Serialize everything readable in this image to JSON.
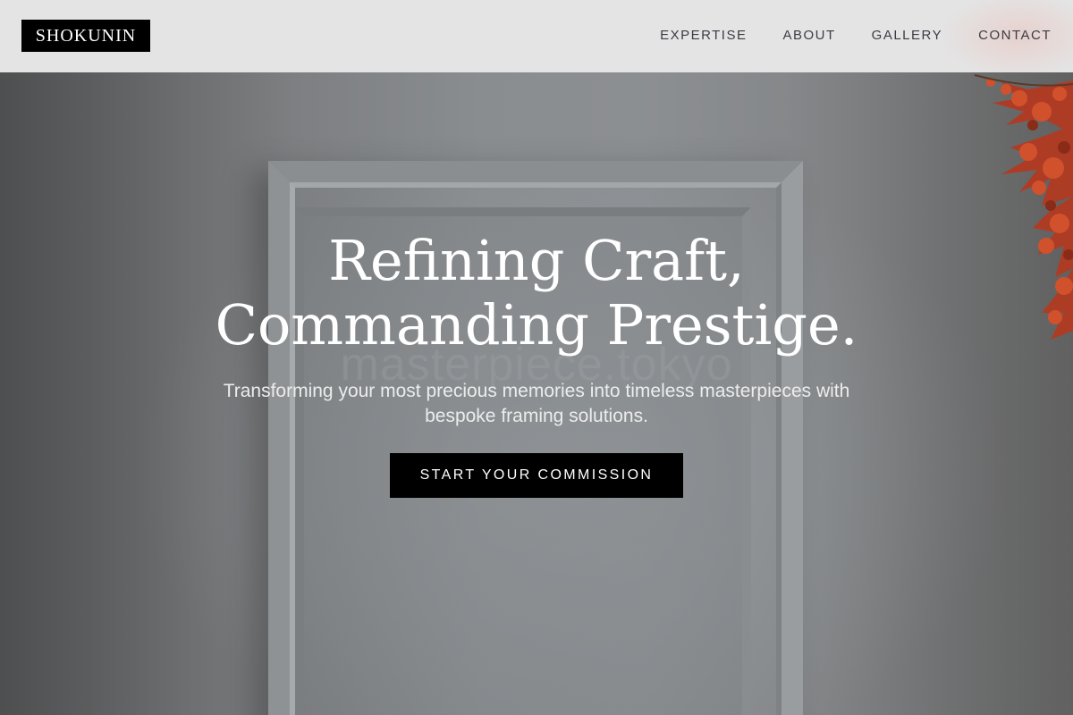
{
  "brand": {
    "logo_text": "SHOKUNIN"
  },
  "nav": {
    "items": [
      {
        "label": "EXPERTISE"
      },
      {
        "label": "ABOUT"
      },
      {
        "label": "GALLERY"
      },
      {
        "label": "CONTACT"
      }
    ]
  },
  "hero": {
    "title_line1": "Refining Craft,",
    "title_line2": "Commanding Prestige.",
    "subtitle_line1": "Transforming your most precious memories into timeless masterpieces with",
    "subtitle_line2": "bespoke framing solutions.",
    "cta_label": "START YOUR COMMISSION",
    "watermark": "masterpiece.tokyo"
  },
  "colors": {
    "header_bg": "#e4e4e4",
    "logo_bg": "#000000",
    "cta_bg": "#000000",
    "nav_text": "#3a3d44",
    "foliage_accent": "#c0392b"
  },
  "icons": {
    "decor": "maple-leaves-icon"
  }
}
